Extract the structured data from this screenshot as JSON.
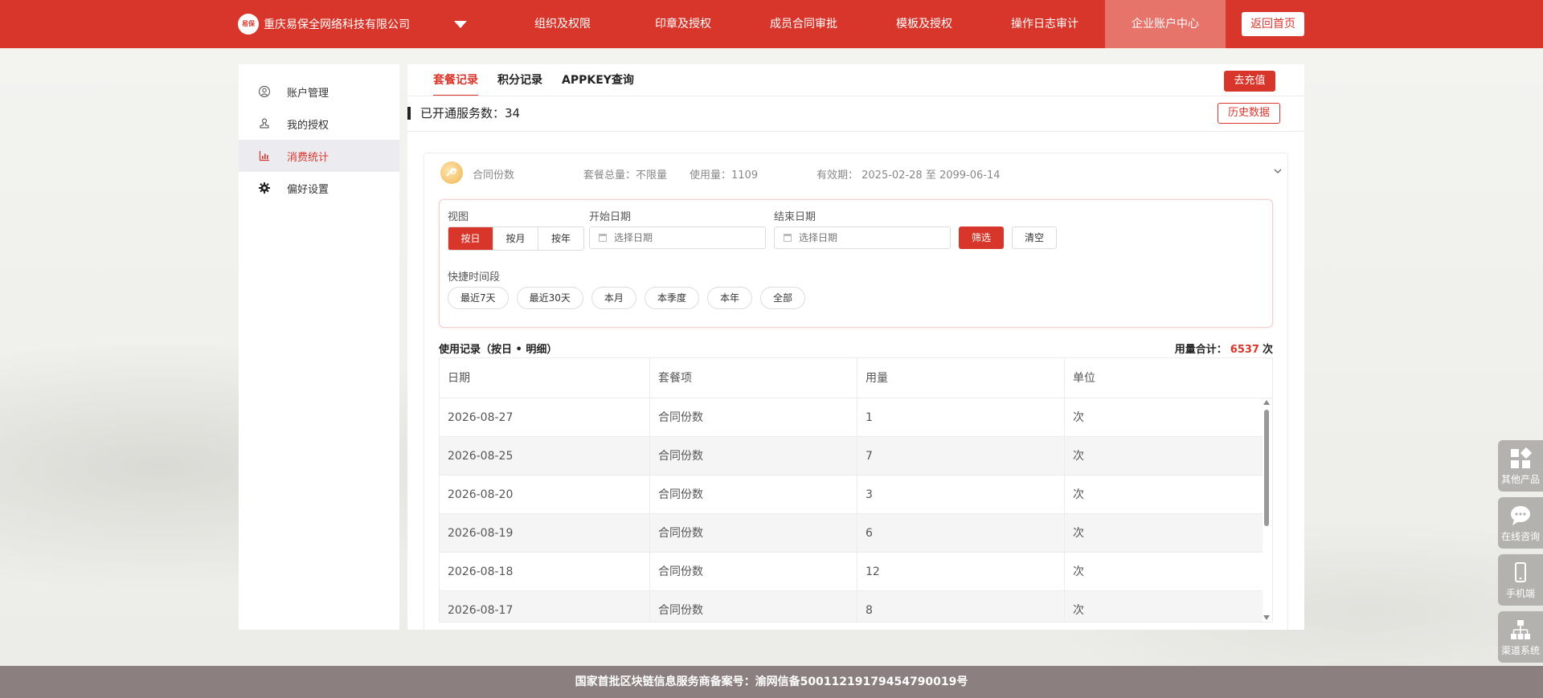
{
  "header": {
    "logo_text": "易保",
    "company": "重庆易保全网络科技有限公司",
    "nav": [
      "组织及权限",
      "印章及授权",
      "成员合同审批",
      "模板及授权",
      "操作日志审计",
      "企业账户中心"
    ],
    "home_button": "返回首页"
  },
  "sidebar": {
    "items": [
      {
        "label": "账户管理",
        "icon": "user-icon"
      },
      {
        "label": "我的授权",
        "icon": "stamp-icon"
      },
      {
        "label": "消费统计",
        "icon": "chart-icon",
        "active": true
      },
      {
        "label": "偏好设置",
        "icon": "gear-icon"
      }
    ]
  },
  "tabs": [
    "套餐记录",
    "积分记录",
    "APPKEY查询"
  ],
  "recharge_button": "去充值",
  "service": {
    "label": "已开通服务数：34",
    "history_button": "历史数据"
  },
  "package": {
    "name": "合同份数",
    "total": "套餐总量：不限量",
    "used": "使用量：1109",
    "validity": "有效期： 2025-02-28 至 2099-06-14"
  },
  "filter": {
    "view_label": "视图",
    "view_options": [
      "按日",
      "按月",
      "按年"
    ],
    "start_label": "开始日期",
    "end_label": "结束日期",
    "date_placeholder": "选择日期",
    "filter_button": "筛选",
    "clear_button": "清空",
    "quick_label": "快捷时间段",
    "quick_options": [
      "最近7天",
      "最近30天",
      "本月",
      "本季度",
      "本年",
      "全部"
    ]
  },
  "usage": {
    "title": "使用记录（按日 • 明细）",
    "total_prefix": "用量合计：",
    "total_value": "6537",
    "total_suffix": "次",
    "columns": [
      "日期",
      "套餐项",
      "用量",
      "单位"
    ],
    "rows": [
      [
        "2026-08-27",
        "合同份数",
        "1",
        "次"
      ],
      [
        "2026-08-25",
        "合同份数",
        "7",
        "次"
      ],
      [
        "2026-08-20",
        "合同份数",
        "3",
        "次"
      ],
      [
        "2026-08-19",
        "合同份数",
        "6",
        "次"
      ],
      [
        "2026-08-18",
        "合同份数",
        "12",
        "次"
      ],
      [
        "2026-08-17",
        "合同份数",
        "8",
        "次"
      ]
    ]
  },
  "float_widgets": [
    {
      "label": "其他产品",
      "icon": "grid-icon"
    },
    {
      "label": "在线咨询",
      "icon": "chat-icon"
    },
    {
      "label": "手机端",
      "icon": "phone-icon"
    },
    {
      "label": "渠道系统",
      "icon": "org-chart-icon"
    }
  ],
  "footer": "国家首批区块链信息服务商备案号：渝网信备50011219179454790019号",
  "colors": {
    "brand": "#d9362b",
    "footer": "#8c7f7f"
  }
}
